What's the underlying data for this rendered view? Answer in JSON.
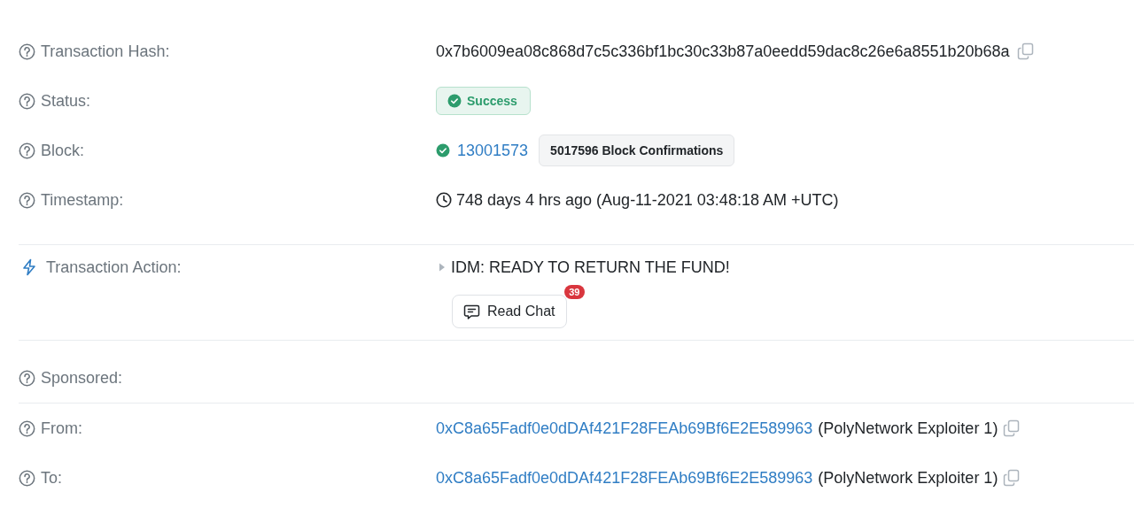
{
  "sections": [
    {
      "rows": [
        {
          "kind": "hash",
          "label": "Transaction Hash:",
          "value": "0x7b6009ea08c868d7c5c336bf1bc30c33b87a0eedd59dac8c26e6a8551b20b68a",
          "copyable": true
        },
        {
          "kind": "status",
          "label": "Status:",
          "status": "Success"
        },
        {
          "kind": "block",
          "label": "Block:",
          "block": "13001573",
          "confirmations": "5017596 Block Confirmations"
        },
        {
          "kind": "timestamp",
          "label": "Timestamp:",
          "value": "748 days 4 hrs ago (Aug-11-2021 03:48:18 AM +UTC)"
        }
      ]
    },
    {
      "rows": [
        {
          "kind": "action",
          "label": "Transaction Action:",
          "value": "IDM: READY TO RETURN THE FUND!",
          "chat_button": "Read Chat",
          "chat_count": "39"
        }
      ]
    },
    {
      "rows": [
        {
          "kind": "empty",
          "label": "Sponsored:"
        }
      ]
    },
    {
      "rows": [
        {
          "kind": "address",
          "label": "From:",
          "address": "0xC8a65Fadf0e0dDAf421F28FEAb69Bf6E2E589963",
          "name": "(PolyNetwork Exploiter 1)",
          "copyable": true
        },
        {
          "kind": "address",
          "label": "To:",
          "address": "0xC8a65Fadf0e0dDAf421F28FEAb69Bf6E2E589963",
          "name": "(PolyNetwork Exploiter 1)",
          "copyable": true
        }
      ]
    }
  ]
}
